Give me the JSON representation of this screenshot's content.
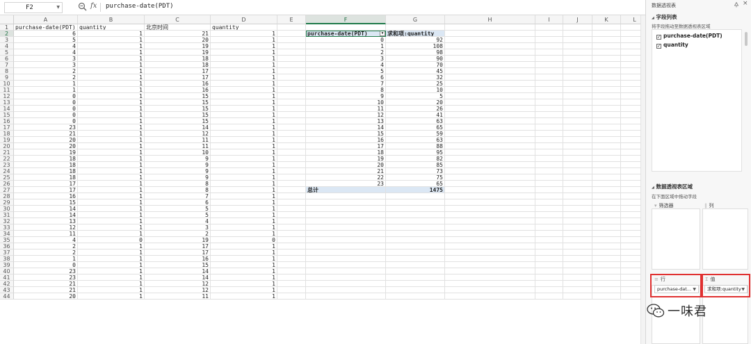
{
  "formula_bar": {
    "name_box": "F2",
    "fx_label": "fx",
    "content": "purchase-date(PDT)"
  },
  "columns": [
    "A",
    "B",
    "C",
    "D",
    "E",
    "F",
    "G",
    "H",
    "I",
    "J",
    "K",
    "L"
  ],
  "selected_column": "F",
  "selected_row": 2,
  "row_numbers": [
    1,
    2,
    3,
    4,
    5,
    6,
    7,
    8,
    9,
    10,
    11,
    12,
    13,
    14,
    15,
    16,
    17,
    18,
    19,
    20,
    21,
    22,
    23,
    24,
    25,
    26,
    27,
    28,
    29,
    30,
    31,
    32,
    33,
    34,
    35,
    36,
    37,
    38,
    39,
    40,
    41,
    42,
    43,
    44
  ],
  "headers": {
    "a": "purchase-date(PDT)",
    "b": "quantity",
    "c": "北京时间",
    "d": "quantity"
  },
  "data_rows": [
    [
      "6",
      "1",
      "21",
      "1"
    ],
    [
      "5",
      "1",
      "20",
      "1"
    ],
    [
      "4",
      "1",
      "19",
      "1"
    ],
    [
      "4",
      "1",
      "19",
      "1"
    ],
    [
      "3",
      "1",
      "18",
      "1"
    ],
    [
      "3",
      "1",
      "18",
      "1"
    ],
    [
      "2",
      "1",
      "17",
      "1"
    ],
    [
      "2",
      "1",
      "17",
      "1"
    ],
    [
      "1",
      "1",
      "16",
      "1"
    ],
    [
      "1",
      "1",
      "16",
      "1"
    ],
    [
      "0",
      "1",
      "15",
      "1"
    ],
    [
      "0",
      "1",
      "15",
      "1"
    ],
    [
      "0",
      "1",
      "15",
      "1"
    ],
    [
      "0",
      "1",
      "15",
      "1"
    ],
    [
      "0",
      "1",
      "15",
      "1"
    ],
    [
      "23",
      "1",
      "14",
      "1"
    ],
    [
      "21",
      "1",
      "12",
      "1"
    ],
    [
      "20",
      "1",
      "11",
      "1"
    ],
    [
      "20",
      "1",
      "11",
      "1"
    ],
    [
      "19",
      "1",
      "10",
      "1"
    ],
    [
      "18",
      "1",
      "9",
      "1"
    ],
    [
      "18",
      "1",
      "9",
      "1"
    ],
    [
      "18",
      "1",
      "9",
      "1"
    ],
    [
      "18",
      "1",
      "9",
      "1"
    ],
    [
      "17",
      "1",
      "8",
      "1"
    ],
    [
      "17",
      "1",
      "8",
      "1"
    ],
    [
      "16",
      "1",
      "7",
      "1"
    ],
    [
      "15",
      "1",
      "6",
      "1"
    ],
    [
      "14",
      "1",
      "5",
      "1"
    ],
    [
      "14",
      "1",
      "5",
      "1"
    ],
    [
      "13",
      "1",
      "4",
      "1"
    ],
    [
      "12",
      "1",
      "3",
      "1"
    ],
    [
      "11",
      "1",
      "2",
      "1"
    ],
    [
      "4",
      "0",
      "19",
      "0"
    ],
    [
      "2",
      "1",
      "17",
      "1"
    ],
    [
      "2",
      "1",
      "17",
      "1"
    ],
    [
      "1",
      "1",
      "16",
      "1"
    ],
    [
      "0",
      "1",
      "15",
      "1"
    ],
    [
      "23",
      "1",
      "14",
      "1"
    ],
    [
      "23",
      "1",
      "14",
      "1"
    ],
    [
      "21",
      "1",
      "12",
      "1"
    ],
    [
      "21",
      "1",
      "12",
      "1"
    ],
    [
      "20",
      "1",
      "11",
      "1"
    ]
  ],
  "pivot": {
    "row_header": "purchase-date(PDT)",
    "value_header": "求和项:quantity",
    "rows": [
      [
        "0",
        "92"
      ],
      [
        "1",
        "108"
      ],
      [
        "2",
        "98"
      ],
      [
        "3",
        "90"
      ],
      [
        "4",
        "70"
      ],
      [
        "5",
        "45"
      ],
      [
        "6",
        "32"
      ],
      [
        "7",
        "25"
      ],
      [
        "8",
        "10"
      ],
      [
        "9",
        "5"
      ],
      [
        "10",
        "20"
      ],
      [
        "11",
        "26"
      ],
      [
        "12",
        "41"
      ],
      [
        "13",
        "63"
      ],
      [
        "14",
        "65"
      ],
      [
        "15",
        "59"
      ],
      [
        "16",
        "63"
      ],
      [
        "17",
        "88"
      ],
      [
        "18",
        "95"
      ],
      [
        "19",
        "82"
      ],
      [
        "20",
        "85"
      ],
      [
        "21",
        "73"
      ],
      [
        "22",
        "75"
      ],
      [
        "23",
        "65"
      ]
    ],
    "total_label": "总计",
    "total_value": "1475"
  },
  "panel": {
    "title": "数据透视表",
    "field_list_title": "字段列表",
    "field_list_hint": "将字段拖动至数据透视表区域",
    "fields": [
      {
        "label": "purchase-date(PDT)",
        "checked": true
      },
      {
        "label": "quantity",
        "checked": true
      }
    ],
    "area_title": "数据透视表区域",
    "area_hint": "在下面区域中拖动字段",
    "filter_label": "筛选器",
    "column_label": "列",
    "row_label": "行",
    "value_label": "值",
    "row_field": "purchase-dat...",
    "value_field": "求和项:quantity",
    "highlight_color": "#e03030"
  },
  "watermark": {
    "text": "一味君"
  },
  "colors": {
    "accent_green": "#1f7a4a",
    "pivot_header_bg": "#dbe7f4"
  }
}
